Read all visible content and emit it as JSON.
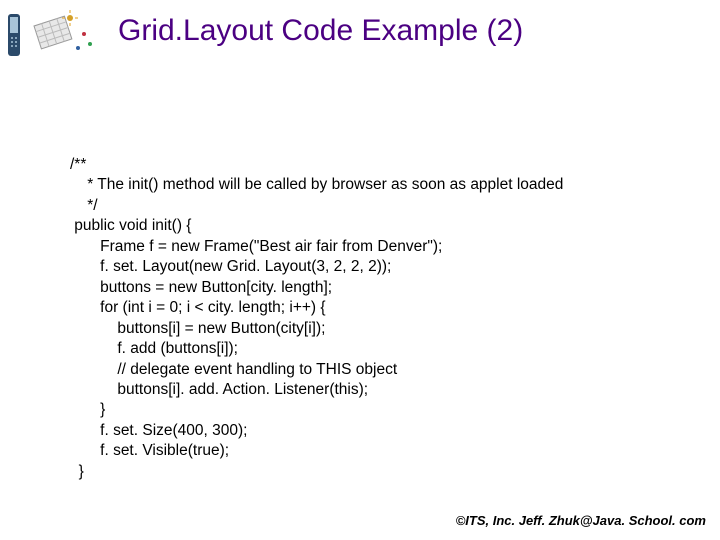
{
  "title": "Grid.Layout Code Example (2)",
  "code": {
    "l01": "/**",
    "l02": "    * The init() method will be called by browser as soon as applet loaded",
    "l03": "    */",
    "l04": " public void init() {",
    "l05": "       Frame f = new Frame(\"Best air fair from Denver\");",
    "l06": "       f. set. Layout(new Grid. Layout(3, 2, 2, 2));",
    "l07": "       buttons = new Button[city. length];",
    "l08": "       for (int i = 0; i < city. length; i++) {",
    "l09": "           buttons[i] = new Button(city[i]);",
    "l10": "           f. add (buttons[i]);",
    "l11": "           // delegate event handling to THIS object",
    "l12": "           buttons[i]. add. Action. Listener(this);",
    "l13": "       }",
    "l14": "       f. set. Size(400, 300);",
    "l15": "       f. set. Visible(true);",
    "l16": "  }"
  },
  "footer": "©ITS, Inc. Jeff. Zhuk@Java. School. com"
}
